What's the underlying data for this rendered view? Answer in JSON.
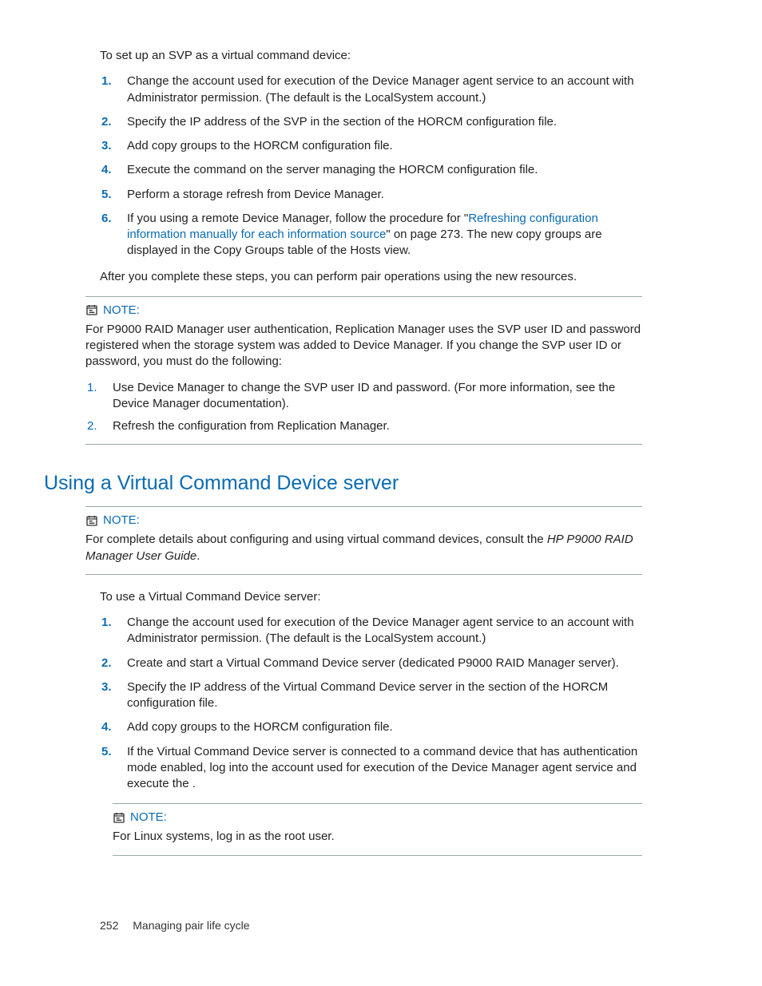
{
  "intro": "To set up an SVP as a virtual command device:",
  "steps1": [
    {
      "num": "1",
      "text": "Change the account used for execution of the Device Manager agent service to an account with Administrator permission. (The default is the LocalSystem account.)"
    },
    {
      "num": "2",
      "text": "Specify the IP address of the SVP in the                 section of the HORCM configuration file."
    },
    {
      "num": "3",
      "text": "Add copy groups to the HORCM configuration file."
    },
    {
      "num": "4",
      "text": "Execute the                          command on the server managing the HORCM configuration file."
    },
    {
      "num": "5",
      "text": "Perform a storage refresh from Device Manager."
    },
    {
      "num": "6",
      "preLink": "If you using a remote Device Manager, follow the procedure for \"",
      "link": "Refreshing configuration information manually for each information source",
      "postLink": "\" on page 273. The new copy groups are displayed in the Copy Groups table of the Hosts view."
    }
  ],
  "after1": "After you complete these steps, you can perform pair operations using the new resources.",
  "note1": {
    "label": "NOTE:",
    "body": "For P9000 RAID Manager user authentication, Replication Manager uses the SVP user ID and password registered when the storage system was added to Device Manager. If you change the SVP user ID or password, you must do the following:",
    "items": [
      {
        "num": "1",
        "text": "Use Device Manager to change the SVP user ID and password. (For more information, see the Device Manager documentation)."
      },
      {
        "num": "2",
        "text": "Refresh the configuration from Replication Manager."
      }
    ]
  },
  "heading2": "Using a Virtual Command Device server",
  "note2": {
    "label": "NOTE:",
    "pre": "For complete details about configuring and using virtual command devices, consult the ",
    "italic": "HP P9000 RAID Manager User Guide",
    "post": "."
  },
  "intro2": "To use a Virtual Command Device server:",
  "steps2": [
    {
      "num": "1",
      "text": "Change the account used for execution of the Device Manager agent service to an account with Administrator permission. (The default is the LocalSystem account.)"
    },
    {
      "num": "2",
      "text": "Create and start a Virtual Command Device server (dedicated P9000 RAID Manager server)."
    },
    {
      "num": "3",
      "text": "Specify the IP address of the Virtual Command Device server in the                 section of the HORCM configuration file."
    },
    {
      "num": "4",
      "text": "Add copy groups to the HORCM configuration file."
    },
    {
      "num": "5",
      "text": "If the Virtual Command Device server is connected to a command device that has authentication mode enabled, log into the account used for execution of the Device Manager agent service and execute the                         ."
    }
  ],
  "note3": {
    "label": "NOTE:",
    "body": "For Linux systems, log in as the root user."
  },
  "footer": {
    "page": "252",
    "title": "Managing pair life cycle"
  }
}
